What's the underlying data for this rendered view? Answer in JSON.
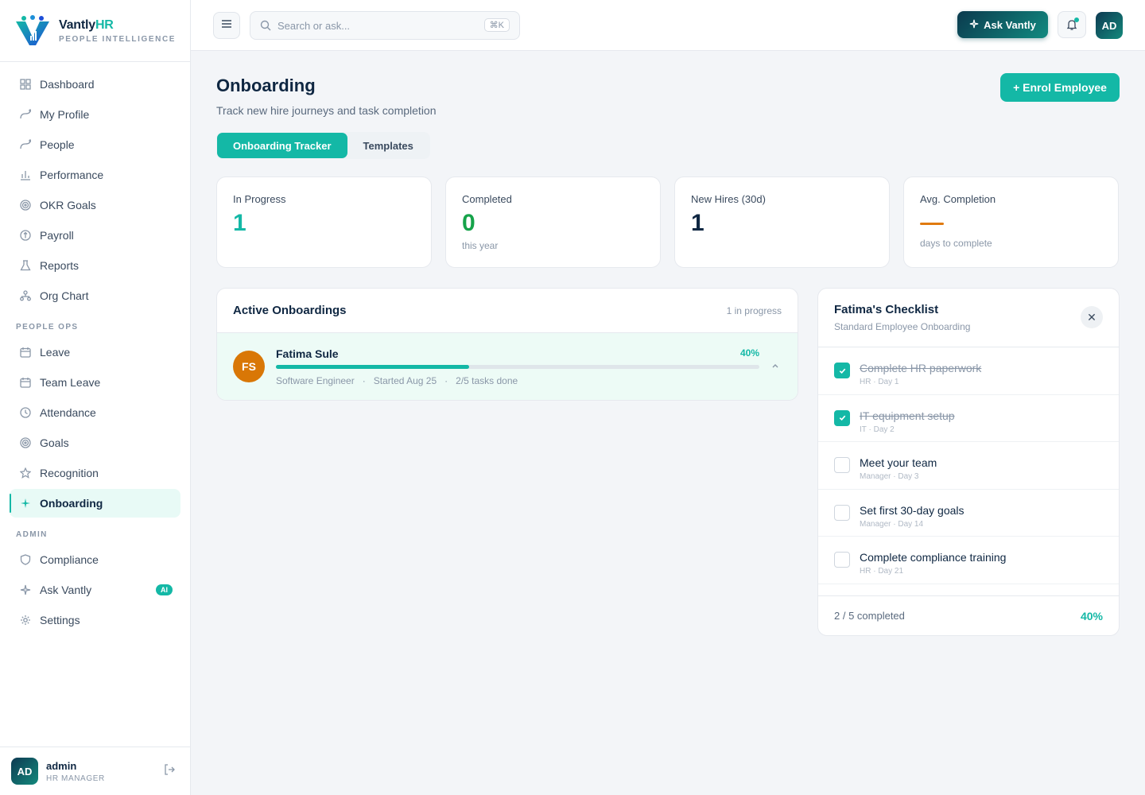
{
  "brand": {
    "name": "Vantly",
    "name_accent": "HR",
    "tagline": "PEOPLE INTELLIGENCE"
  },
  "sidebar": {
    "main": [
      {
        "label": "Dashboard",
        "icon": "grid-icon"
      },
      {
        "label": "My Profile",
        "icon": "route-icon"
      },
      {
        "label": "People",
        "icon": "route-icon"
      },
      {
        "label": "Performance",
        "icon": "bar-chart-icon"
      },
      {
        "label": "OKR Goals",
        "icon": "target-icon"
      },
      {
        "label": "Payroll",
        "icon": "coin-icon"
      },
      {
        "label": "Reports",
        "icon": "flask-icon"
      },
      {
        "label": "Org Chart",
        "icon": "org-chart-icon"
      }
    ],
    "people_ops_label": "PEOPLE OPS",
    "people_ops": [
      {
        "label": "Leave",
        "icon": "calendar-icon"
      },
      {
        "label": "Team Leave",
        "icon": "calendar-icon"
      },
      {
        "label": "Attendance",
        "icon": "clock-icon"
      },
      {
        "label": "Goals",
        "icon": "target-icon"
      },
      {
        "label": "Recognition",
        "icon": "star-icon"
      },
      {
        "label": "Onboarding",
        "icon": "sparkle-icon",
        "active": true
      }
    ],
    "admin_label": "ADMIN",
    "admin": [
      {
        "label": "Compliance",
        "icon": "shield-icon"
      },
      {
        "label": "Ask Vantly",
        "icon": "sparkle-icon",
        "badge": "AI"
      },
      {
        "label": "Settings",
        "icon": "gear-icon"
      }
    ],
    "user": {
      "initials": "AD",
      "name": "admin",
      "role": "HR MANAGER"
    }
  },
  "topbar": {
    "search_placeholder": "Search or ask...",
    "shortcut": "⌘K",
    "ask_label": "Ask Vantly",
    "avatar_initials": "AD"
  },
  "page": {
    "title": "Onboarding",
    "subtitle": "Track new hire journeys and task completion",
    "enrol_label": "+ Enrol Employee",
    "tabs": [
      {
        "label": "Onboarding Tracker",
        "active": true
      },
      {
        "label": "Templates",
        "active": false
      }
    ]
  },
  "stats": [
    {
      "label": "In Progress",
      "value": "1",
      "note": "",
      "color": "#14b8a6"
    },
    {
      "label": "Completed",
      "value": "0",
      "note": "this year",
      "color": "#16a34a"
    },
    {
      "label": "New Hires (30d)",
      "value": "1",
      "note": "",
      "color": "#0f2742"
    },
    {
      "label": "Avg. Completion",
      "value": "",
      "note": "days to complete",
      "color": "#e07a10"
    }
  ],
  "active_onboardings": {
    "title": "Active Onboardings",
    "meta": "1 in progress",
    "items": [
      {
        "initials": "FS",
        "name": "Fatima Sule",
        "progress_label": "40%",
        "progress": 0.4,
        "role": "Software Engineer",
        "started": "Started Aug 25",
        "tasks": "2/5 tasks done"
      }
    ]
  },
  "checklist": {
    "title": "Fatima's Checklist",
    "subtitle": "Standard Employee Onboarding",
    "tasks": [
      {
        "name": "Complete HR paperwork",
        "meta": "HR · Day 1",
        "done": true
      },
      {
        "name": "IT equipment setup",
        "meta": "IT · Day 2",
        "done": true
      },
      {
        "name": "Meet your team",
        "meta": "Manager · Day 3",
        "done": false
      },
      {
        "name": "Set first 30-day goals",
        "meta": "Manager · Day 14",
        "done": false
      },
      {
        "name": "Complete compliance training",
        "meta": "HR · Day 21",
        "done": false
      }
    ],
    "count_label": "2 / 5 completed",
    "pct_label": "40%"
  },
  "colors": {
    "accent": "#14b8a6",
    "navy": "#0f2742",
    "orange": "#d97706"
  }
}
